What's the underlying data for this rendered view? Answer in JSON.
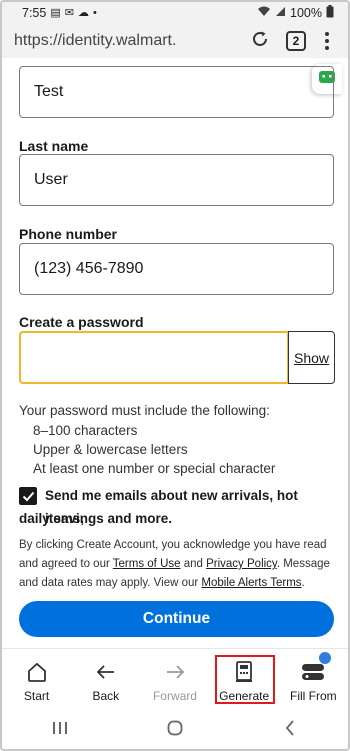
{
  "status_bar": {
    "time": "7:55",
    "battery": "100%"
  },
  "browser": {
    "url": "https://identity.walmart.",
    "tab_count": "2"
  },
  "form": {
    "first_name_value": "Test",
    "last_name_label": "Last name",
    "last_name_value": "User",
    "phone_label": "Phone number",
    "phone_value": "(123) 456-7890",
    "password_label": "Create a password",
    "password_value": "",
    "show_label": "Show",
    "rules_title": "Your password must include the following:",
    "rules": [
      "8–100 characters",
      "Upper & lowercase letters",
      "At least one number or special character"
    ],
    "email_opt_in_line1": "Send me emails about new arrivals, hot items,",
    "email_opt_in_line2": "daily savings and more.",
    "legal_part1": "By clicking Create Account, you acknowledge you have read and agreed to our ",
    "terms_link": "Terms of Use",
    "legal_and": " and ",
    "privacy_link": "Privacy Policy",
    "legal_part2": ". Message and data rates may apply. View our ",
    "alerts_link": "Mobile Alerts Terms",
    "legal_end": ".",
    "continue_label": "Continue"
  },
  "toolbar": {
    "items": [
      {
        "label": "Start",
        "icon": "home-icon"
      },
      {
        "label": "Back",
        "icon": "arrow-left-icon"
      },
      {
        "label": "Forward",
        "icon": "arrow-right-icon"
      },
      {
        "label": "Generate",
        "icon": "generate-icon"
      },
      {
        "label": "Fill From",
        "icon": "fill-from-icon"
      }
    ]
  },
  "colors": {
    "accent": "#0071dc",
    "focus_border": "#f0b62a",
    "highlight": "#e01a1a",
    "badge": "#2f7de1"
  }
}
